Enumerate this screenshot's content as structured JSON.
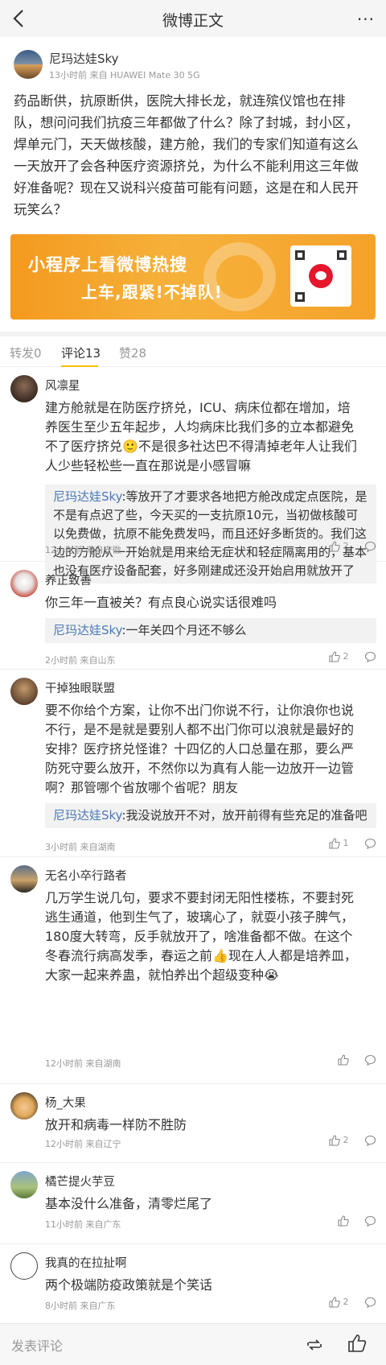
{
  "nav": {
    "title": "微博正文",
    "more_label": "···",
    "back_icon": "chevron-left-icon"
  },
  "post": {
    "author_name": "尼玛达娃Sky",
    "meta": "13小时前 来自 HUAWEI Mate 30 5G",
    "text_lines": [
      "药品断供，抗原断供，医院大排长龙，就连殡仪馆也在排",
      "队，想问问我们抗疫三年都做了什么？除了封城，封小区，",
      "焊单元门，天天做核酸，建方舱，我们的专家们知道有这么",
      "一天放开了会各种医疗资源挤兑，为什么不能利用这三年做",
      "好准备呢？现在又说科兴疫苗可能有问题，这是在和人民开",
      "玩笑么？"
    ]
  },
  "banner": {
    "line1": "小程序上看微博热搜",
    "line2": "上车,跟紧!不掉队!"
  },
  "tabs": [
    {
      "label": "转发0",
      "active": false
    },
    {
      "label": "评论13",
      "active": true
    },
    {
      "label": "赞28",
      "active": false
    }
  ],
  "comments": [
    {
      "name": "风凛星",
      "body_lines": [
        "建方舱就是在防医疗挤兑，ICU、病床位都在增加，培",
        "养医生至少五年起步，人均病床比我们多的立本都避免",
        "不了医疗挤兑🙂不是很多社达巴不得清掉老年人让我们",
        "人少些轻松些一直在那说是小感冒嘛"
      ],
      "reply_name": "尼玛达娃Sky",
      "reply_lines": [
        ":等放开了才要求各地把方舱改成定点医院，是",
        "不是有点迟了些，今天买的一支抗原10元，当初做核酸可",
        "以免费做，抗原不能免费发吗，而且还好多断货的。我们这",
        "边的方舱从一开始就是用来给无症状和轻症隔离用的，基本",
        "也没有医疗设备配套，好多刚建成还没开始启用就放开了"
      ],
      "meta": "12小时前 来自安徽",
      "likes": "2"
    },
    {
      "name": "养正致善",
      "body_lines": [
        "你三年一直被关？有点良心说实话很难吗"
      ],
      "reply_name": "尼玛达娃Sky",
      "reply_lines": [
        ":一年关四个月还不够么"
      ],
      "meta": "2小时前 来自山东",
      "likes": "2"
    },
    {
      "name": "干掉独眼联盟",
      "body_lines": [
        "要不你给个方案，让你不出门你说不行，让你浪你也说",
        "不行，是不是就是要别人都不出门你可以浪就是最好的",
        "安排？医疗挤兑怪谁？十四亿的人口总量在那，要么严",
        "防死守要么放开，不然你以为真有人能一边放开一边管",
        "啊？那管哪个省放哪个省呢？朋友"
      ],
      "reply_name": "尼玛达娃Sky",
      "reply_lines": [
        ":我没说放开不对，放开前得有些充足的准备吧"
      ],
      "meta": "3小时前 来自湖南",
      "likes": "1"
    },
    {
      "name": "无名小卒行路者",
      "body_lines": [
        "几万学生说几句，要求不要封闭无阳性楼栋，不要封死",
        "逃生通道，他到生气了，玻璃心了，就耍小孩子脾气，",
        "180度大转弯，反手就放开了，啥准备都不做。在这个",
        "冬春流行病高发季，春运之前👍现在人人都是培养皿，",
        "大家一起来养蛊，就怕养出个超级变种😭"
      ],
      "meta": "12小时前 来自湖南",
      "likes": ""
    },
    {
      "name": "杨_大果",
      "body_lines": [
        "放开和病毒一样防不胜防"
      ],
      "meta": "12小时前 来自辽宁",
      "likes": "2"
    },
    {
      "name": "橘芒提火芋豆",
      "body_lines": [
        "基本没什么准备，清零烂尾了"
      ],
      "meta": "11小时前 来自广东",
      "likes": ""
    },
    {
      "name": "我真的在拉扯啊",
      "body_lines": [
        "两个极端防疫政策就是个笑话"
      ],
      "meta": "8小时前 来自广东",
      "likes": "2"
    }
  ],
  "bottom": {
    "input_placeholder": "发表评论"
  },
  "colors": {
    "accent_tab": "#f7c000",
    "link": "#4a7ab8",
    "banner": "#f5a22a"
  }
}
